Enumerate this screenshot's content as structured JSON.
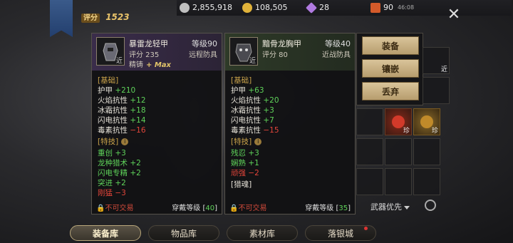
{
  "currencies": [
    {
      "icon": "silver-coin-icon",
      "value": "2,855,918",
      "color": "#bfbfbf"
    },
    {
      "icon": "gold-coin-icon",
      "value": "108,505",
      "color": "#e0b23a"
    },
    {
      "icon": "diamond-icon",
      "value": "28",
      "color": "#b07ae0"
    },
    {
      "icon": "feather-icon",
      "value": "90",
      "color": "#d35a2a"
    }
  ],
  "clock": "46:08",
  "score": {
    "label": "评分",
    "value": "1523"
  },
  "item_left": {
    "name": "暴雷龙轻甲",
    "level": "等级90",
    "score": "评分 235",
    "type": "远程防具",
    "cast": "精铸",
    "cast_bonus": "+ Max",
    "corner": "近",
    "base_header": "[基础]",
    "base": [
      {
        "label": "护甲",
        "value": "+210",
        "tone": "g"
      },
      {
        "label": "火焰抗性",
        "value": "+12",
        "tone": "g"
      },
      {
        "label": "冰霜抗性",
        "value": "+18",
        "tone": "g"
      },
      {
        "label": "闪电抗性",
        "value": "+14",
        "tone": "g"
      },
      {
        "label": "毒素抗性",
        "value": "−16",
        "tone": "r"
      }
    ],
    "skill_header": "[特技]",
    "skills": [
      {
        "text": "重创 +3",
        "tone": "g"
      },
      {
        "text": "龙种猎术 +2",
        "tone": "g"
      },
      {
        "text": "闪电专精 +2",
        "tone": "g"
      },
      {
        "text": "突进 +2",
        "tone": "g"
      },
      {
        "text": "刚猛 −3",
        "tone": "r"
      }
    ],
    "untradeable": "不可交易",
    "wear_label": "穿戴等级",
    "wear_level": "40"
  },
  "item_right": {
    "name": "黯骨龙胸甲",
    "level": "等级40",
    "score": "评分 80",
    "type": "近战防具",
    "corner": "近",
    "base_header": "[基础]",
    "base": [
      {
        "label": "护甲",
        "value": "+63",
        "tone": "g"
      },
      {
        "label": "火焰抗性",
        "value": "+20",
        "tone": "g"
      },
      {
        "label": "冰霜抗性",
        "value": "+3",
        "tone": "g"
      },
      {
        "label": "闪电抗性",
        "value": "+7",
        "tone": "g"
      },
      {
        "label": "毒素抗性",
        "value": "−15",
        "tone": "r"
      }
    ],
    "skill_header": "[特技]",
    "skills": [
      {
        "text": "残忍 +3",
        "tone": "g"
      },
      {
        "text": "娴熟 +1",
        "tone": "g"
      },
      {
        "text": "顽强 −2",
        "tone": "r"
      }
    ],
    "soul_header": "[猎魂]",
    "untradeable": "不可交易",
    "wear_label": "穿戴等级",
    "wear_level": "35"
  },
  "actions": {
    "equip": "装备",
    "inlay": "镶嵌",
    "discard": "丢弃"
  },
  "grid_tags": [
    "近",
    "珍",
    "珍"
  ],
  "weapon_priority": "武器优先",
  "tabs": [
    "装备库",
    "物品库",
    "素材库",
    "落银城"
  ]
}
